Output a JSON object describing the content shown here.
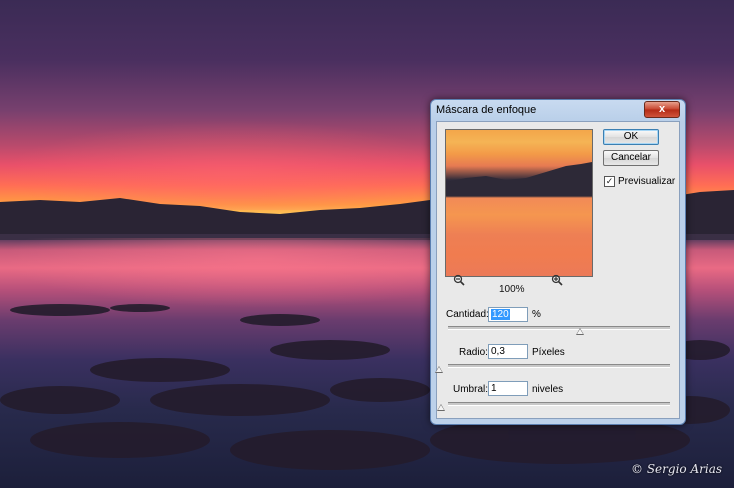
{
  "dialog": {
    "title": "Máscara de enfoque",
    "close_label": "x",
    "ok_label": "OK",
    "cancel_label": "Cancelar",
    "preview_label": "Previsualizar",
    "preview_checked": true,
    "zoom_level": "100%",
    "amount": {
      "label": "Cantidad:",
      "value": "120",
      "unit": "%",
      "slider_fraction": 0.6
    },
    "radius": {
      "label": "Radio:",
      "value": "0,3",
      "unit": "Píxeles",
      "slider_fraction": 0.0
    },
    "threshold": {
      "label": "Umbral:",
      "value": "1",
      "unit": "niveles",
      "slider_fraction": 0.004
    }
  },
  "photo": {
    "signature": "© Sergio Arias"
  }
}
